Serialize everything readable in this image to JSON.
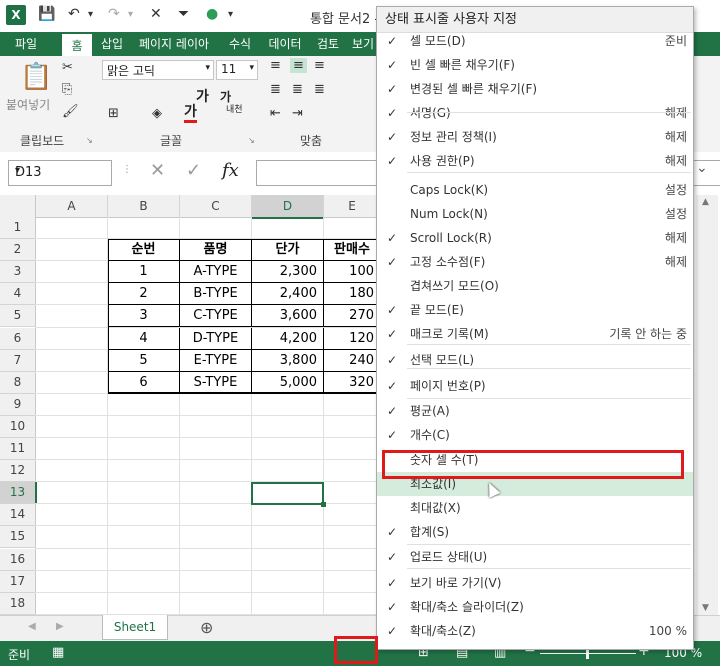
{
  "window": {
    "title": "통합 문서2 -"
  },
  "ribbon_tabs": [
    "파일",
    "홈",
    "삽입",
    "페이지 레이아",
    "수식",
    "데이터",
    "검토",
    "보기"
  ],
  "ribbon": {
    "clipboard": {
      "paste_label": "붙여넣기",
      "group_label": "클립보드"
    },
    "font": {
      "name": "맑은 고딕",
      "size": "11",
      "group_label": "글꼴",
      "bold": "가",
      "text_color": "가",
      "grow": "가",
      "shrink": "가",
      "phonetic": "내천"
    },
    "alignment": {
      "group_label": "맞춤"
    }
  },
  "formula_bar": {
    "name_box": "D13",
    "fx": "fx",
    "value": ""
  },
  "grid": {
    "columns": [
      "A",
      "B",
      "C",
      "D",
      "E"
    ],
    "rows": [
      "1",
      "2",
      "3",
      "4",
      "5",
      "6",
      "7",
      "8",
      "9",
      "10",
      "11",
      "12",
      "13",
      "14",
      "15",
      "16",
      "17",
      "18"
    ],
    "table_headers": [
      "순번",
      "품명",
      "단가",
      "판매수"
    ],
    "table_rows": [
      [
        "1",
        "A-TYPE",
        "2,300",
        "100"
      ],
      [
        "2",
        "B-TYPE",
        "2,400",
        "180"
      ],
      [
        "3",
        "C-TYPE",
        "3,600",
        "270"
      ],
      [
        "4",
        "D-TYPE",
        "4,200",
        "120"
      ],
      [
        "5",
        "E-TYPE",
        "3,800",
        "240"
      ],
      [
        "6",
        "S-TYPE",
        "5,000",
        "320"
      ]
    ],
    "selected_cell": "D13"
  },
  "sheet_tabs": [
    "Sheet1"
  ],
  "status_bar": {
    "mode": "준비",
    "zoom": "100 %"
  },
  "context_menu": {
    "title": "상태 표시줄 사용자 지정",
    "items": [
      {
        "label": "셀 모드(D)",
        "value": "준비",
        "checked": true
      },
      {
        "label": "빈 셀 빠른 채우기(F)",
        "value": "",
        "checked": true
      },
      {
        "label": "변경된 셀 빠른 채우기(F)",
        "value": "",
        "checked": true
      },
      {
        "label": "서명(G)",
        "value": "해제",
        "checked": true
      },
      {
        "label": "정보 관리 정책(I)",
        "value": "해제",
        "checked": true
      },
      {
        "label": "사용 권한(P)",
        "value": "해제",
        "checked": true
      },
      {
        "label": "Caps Lock(K)",
        "value": "설정",
        "checked": false
      },
      {
        "label": "Num Lock(N)",
        "value": "설정",
        "checked": false
      },
      {
        "label": "Scroll Lock(R)",
        "value": "해제",
        "checked": true
      },
      {
        "label": "고정 소수점(F)",
        "value": "해제",
        "checked": true
      },
      {
        "label": "겹쳐쓰기 모드(O)",
        "value": "",
        "checked": false
      },
      {
        "label": "끝 모드(E)",
        "value": "",
        "checked": true
      },
      {
        "label": "매크로 기록(M)",
        "value": "기록 안 하는 중",
        "checked": true
      },
      {
        "label": "선택 모드(L)",
        "value": "",
        "checked": true
      },
      {
        "label": "페이지 번호(P)",
        "value": "",
        "checked": true
      },
      {
        "label": "평균(A)",
        "value": "",
        "checked": true
      },
      {
        "label": "개수(C)",
        "value": "",
        "checked": true
      },
      {
        "label": "숫자 셀 수(T)",
        "value": "",
        "checked": false
      },
      {
        "label": "최소값(I)",
        "value": "",
        "checked": false
      },
      {
        "label": "최대값(X)",
        "value": "",
        "checked": false
      },
      {
        "label": "합계(S)",
        "value": "",
        "checked": true
      },
      {
        "label": "업로드 상태(U)",
        "value": "",
        "checked": true
      },
      {
        "label": "보기 바로 가기(V)",
        "value": "",
        "checked": true
      },
      {
        "label": "확대/축소 슬라이더(Z)",
        "value": "",
        "checked": true
      },
      {
        "label": "확대/축소(Z)",
        "value": "100 %",
        "checked": true
      }
    ],
    "highlighted_item": "숫자 셀 수(T)",
    "hovered_item": "최소값(I)"
  },
  "colors": {
    "excel_green": "#217346",
    "annotation_red": "#e0191a",
    "hover_green": "#d5ecdd"
  }
}
